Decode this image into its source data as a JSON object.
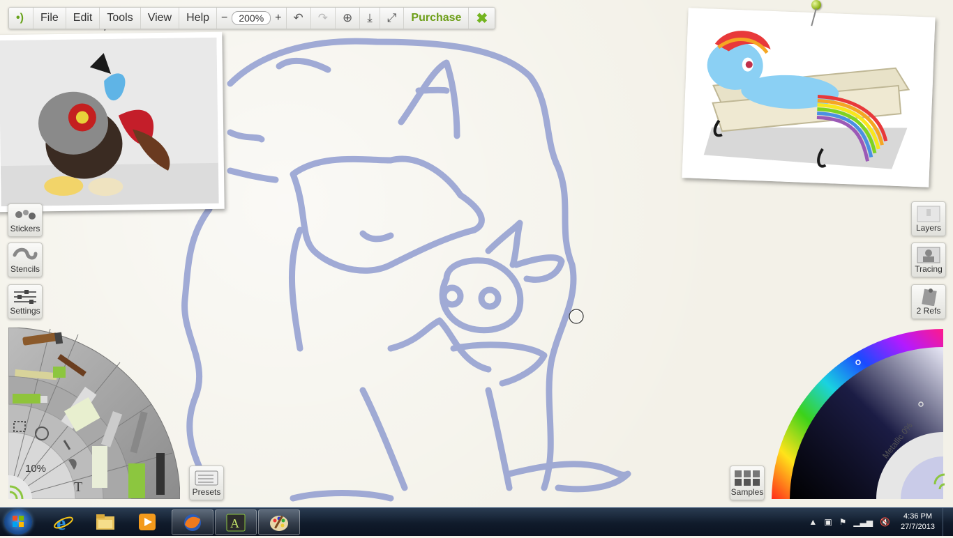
{
  "menu": {
    "file": "File",
    "edit": "Edit",
    "tools": "Tools",
    "view": "View",
    "help": "Help",
    "zoom_out": "−",
    "zoom_level": "200%",
    "zoom_in": "+",
    "purchase": "Purchase",
    "close": "✖"
  },
  "left_panel": {
    "stickers": "Stickers",
    "stencils": "Stencils",
    "settings": "Settings",
    "presets": "Presets",
    "brush_size": "10%"
  },
  "right_panel": {
    "layers": "Layers",
    "tracing": "Tracing",
    "refs": "2 Refs",
    "samples": "Samples",
    "metallic": "Metallic 0%"
  },
  "taskbar": {
    "time": "4:36 PM",
    "date": "27/7/2013"
  },
  "colors": {
    "accent": "#7ab51d",
    "sketch": "#7f8ecb",
    "taskbar": "#142032"
  }
}
